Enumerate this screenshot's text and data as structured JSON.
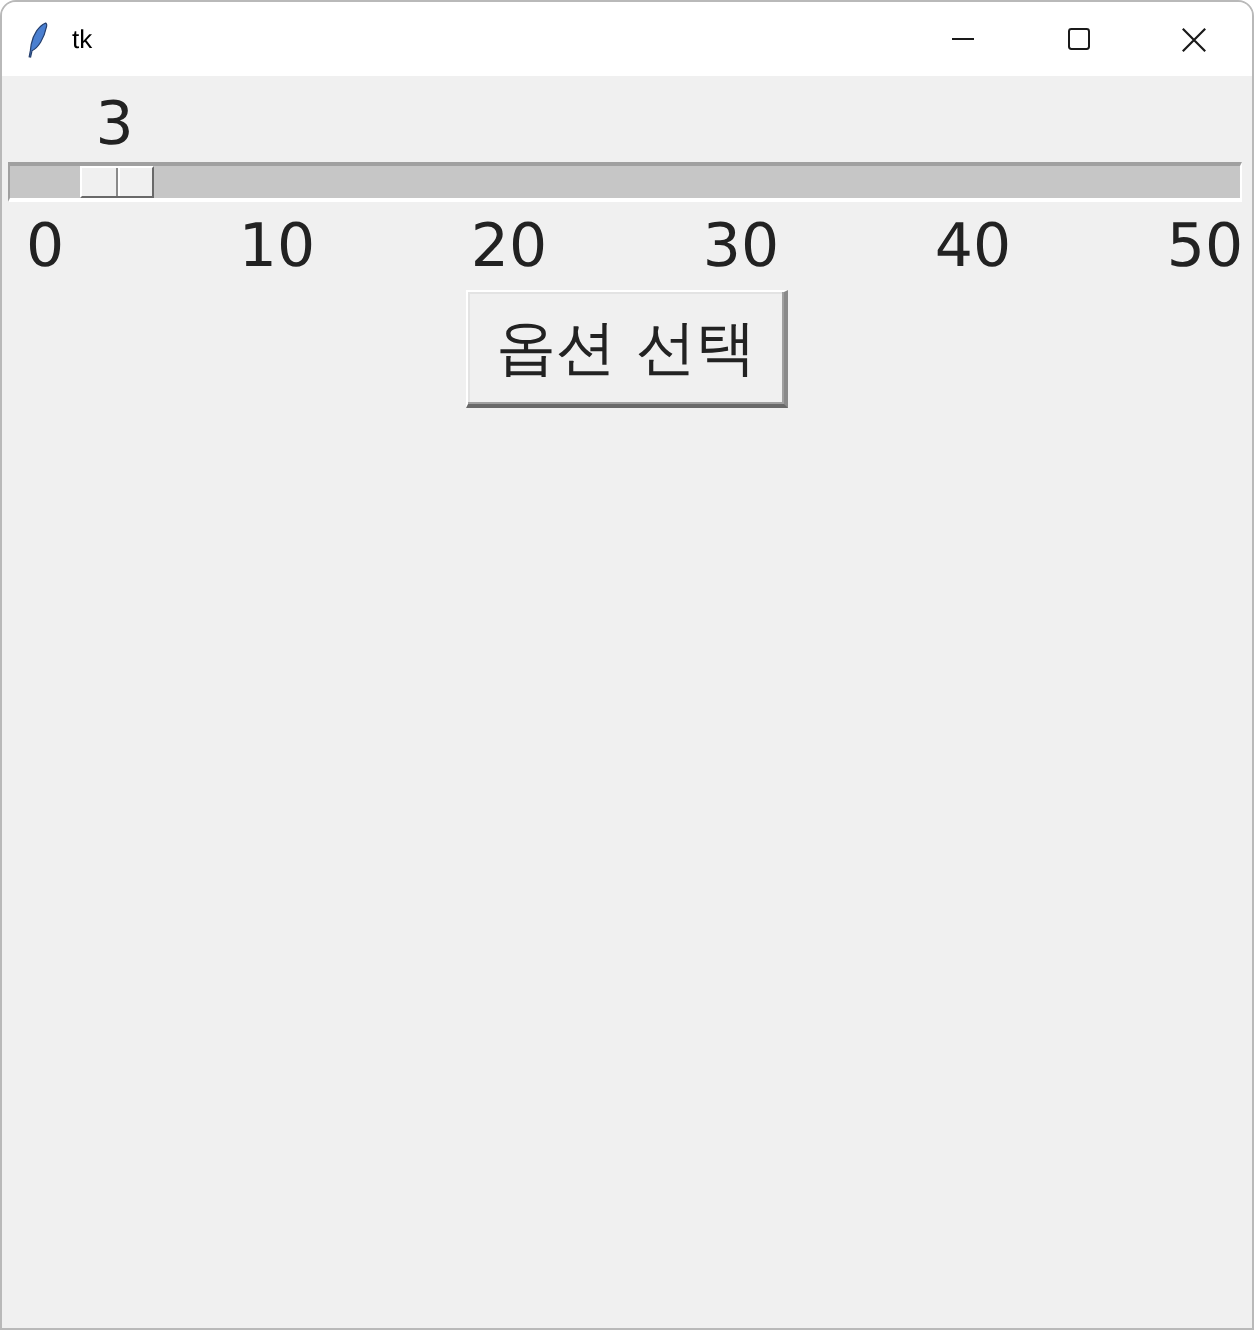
{
  "window": {
    "title": "tk"
  },
  "slider": {
    "value": "3",
    "level": 0.06,
    "ticks": [
      "0",
      "10",
      "20",
      "30",
      "40",
      "50"
    ]
  },
  "button": {
    "label": "옵션 선택"
  }
}
